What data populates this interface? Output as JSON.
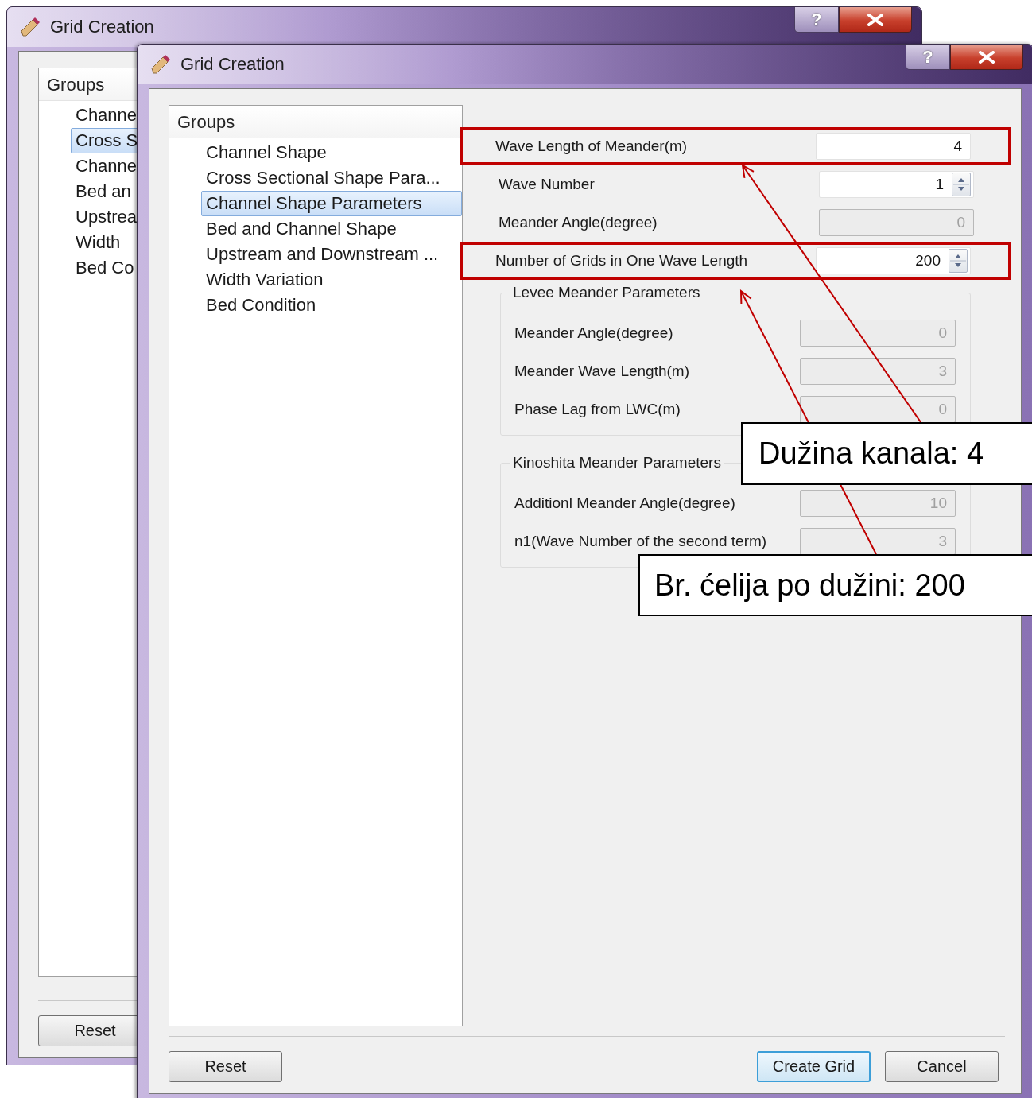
{
  "back_window": {
    "title": "Grid Creation",
    "title_buttons": [
      "?"
    ],
    "tree": {
      "header": "Groups",
      "items": [
        {
          "label": "Channe",
          "selected": false
        },
        {
          "label": "Cross S",
          "selected": true
        },
        {
          "label": "Channe",
          "selected": false
        },
        {
          "label": "Bed an",
          "selected": false
        },
        {
          "label": "Upstrea",
          "selected": false
        },
        {
          "label": "Width",
          "selected": false
        },
        {
          "label": "Bed Co",
          "selected": false
        }
      ]
    },
    "buttons": [
      {
        "label": "Reset",
        "default": false
      }
    ]
  },
  "front_window": {
    "title": "Grid Creation",
    "title_buttons": [
      "?"
    ],
    "tree": {
      "header": "Groups",
      "items": [
        {
          "label": "Channel Shape",
          "selected": false
        },
        {
          "label": "Cross Sectional Shape Para...",
          "selected": false
        },
        {
          "label": "Channel Shape Parameters",
          "selected": true
        },
        {
          "label": "Bed and Channel Shape",
          "selected": false
        },
        {
          "label": "Upstream and Downstream ...",
          "selected": false
        },
        {
          "label": "Width Variation",
          "selected": false
        },
        {
          "label": "Bed Condition",
          "selected": false
        }
      ]
    },
    "fields": [
      {
        "label": "Wave Length of Meander(m)",
        "value": "4",
        "kind": "plain",
        "disabled": false,
        "highlighted": true
      },
      {
        "label": "Wave Number",
        "value": "1",
        "kind": "spin",
        "disabled": false,
        "highlighted": false
      },
      {
        "label": "Meander Angle(degree)",
        "value": "0",
        "kind": "plain",
        "disabled": true,
        "highlighted": false
      },
      {
        "label": "Number of Grids in One Wave Length",
        "value": "200",
        "kind": "spin",
        "disabled": false,
        "highlighted": true
      }
    ],
    "groups": [
      {
        "title": "Levee Meander Parameters",
        "fields": [
          {
            "label": "Meander Angle(degree)",
            "value": "0",
            "disabled": true
          },
          {
            "label": "Meander Wave Length(m)",
            "value": "3",
            "disabled": true
          },
          {
            "label": "Phase Lag from LWC(m)",
            "value": "0",
            "disabled": true
          }
        ]
      },
      {
        "title": "Kinoshita Meander Parameters",
        "fields": [
          {
            "label": "Additionl Meander Angle(degree)",
            "value": "10",
            "disabled": true
          },
          {
            "label": "n1(Wave Number of the second term)",
            "value": "3",
            "disabled": true
          }
        ]
      }
    ],
    "buttons": [
      {
        "label": "Reset",
        "default": false
      },
      {
        "label": "Create Grid",
        "default": true
      },
      {
        "label": "Cancel",
        "default": false
      }
    ]
  },
  "annotations": [
    {
      "text": "Dužina kanala: 4"
    },
    {
      "text": "Br. ćelija po dužini: 200"
    }
  ]
}
